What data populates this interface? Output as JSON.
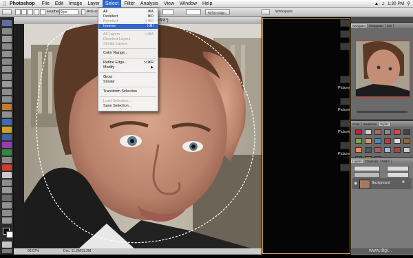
{
  "menubar": {
    "apple": "",
    "app": "Photoshop",
    "items": [
      "File",
      "Edit",
      "Image",
      "Layer",
      "Select",
      "Filter",
      "Analysis",
      "View",
      "Window",
      "Help"
    ],
    "active_item": "Select",
    "right": {
      "time": "1:30 PM"
    }
  },
  "options_bar": {
    "feather_label": "Feather:",
    "feather_value": "0 px",
    "antialias_label": "Anti-alias",
    "refine_edge": "Refine Edge...",
    "workspace": "Workspace"
  },
  "document": {
    "title": "Ex. (RGB/8*)",
    "zoom": "66.67%",
    "doc_info": "Doc: 11.2M/11.2M"
  },
  "select_menu": {
    "items": [
      {
        "label": "All",
        "shortcut": "⌘A",
        "state": "normal"
      },
      {
        "label": "Deselect",
        "shortcut": "⌘D",
        "state": "normal"
      },
      {
        "label": "Reselect",
        "shortcut": "⇧⌘D",
        "state": "disabled"
      },
      {
        "label": "Inverse",
        "shortcut": "⇧⌘I",
        "state": "highlighted"
      },
      {
        "sep": true
      },
      {
        "label": "All Layers",
        "shortcut": "⌥⌘A",
        "state": "disabled"
      },
      {
        "label": "Deselect Layers",
        "shortcut": "",
        "state": "disabled"
      },
      {
        "label": "Similar Layers",
        "shortcut": "",
        "state": "disabled"
      },
      {
        "sep": true
      },
      {
        "label": "Color Range...",
        "shortcut": "",
        "state": "normal"
      },
      {
        "sep": true
      },
      {
        "label": "Refine Edge...",
        "shortcut": "⌥⌘R",
        "state": "normal"
      },
      {
        "label": "Modify",
        "shortcut": "▶",
        "state": "normal"
      },
      {
        "sep": true
      },
      {
        "label": "Grow",
        "shortcut": "",
        "state": "normal"
      },
      {
        "label": "Similar",
        "shortcut": "",
        "state": "normal"
      },
      {
        "sep": true
      },
      {
        "label": "Transform Selection",
        "shortcut": "",
        "state": "normal"
      },
      {
        "sep": true
      },
      {
        "label": "Load Selection...",
        "shortcut": "",
        "state": "disabled"
      },
      {
        "label": "Save Selection...",
        "shortcut": "",
        "state": "normal"
      }
    ]
  },
  "dock": {
    "labels": [
      "Picture",
      "Picture",
      "Picture",
      "Picture"
    ]
  },
  "panels": {
    "navigator": {
      "tabs": [
        "Navigator",
        "Histogram",
        "Info"
      ]
    },
    "swatches": {
      "tabs": [
        "Color",
        "Swatches",
        "Styles"
      ]
    },
    "layers": {
      "tabs": [
        "Layers",
        "Channels",
        "Paths"
      ],
      "layer_name": "Background"
    }
  },
  "colors": {
    "menu_highlight": "#2f63d6",
    "panel_gray": "#6a6a6a",
    "frame_yellow": "#c8a21f"
  },
  "watermark": "www.digi..."
}
